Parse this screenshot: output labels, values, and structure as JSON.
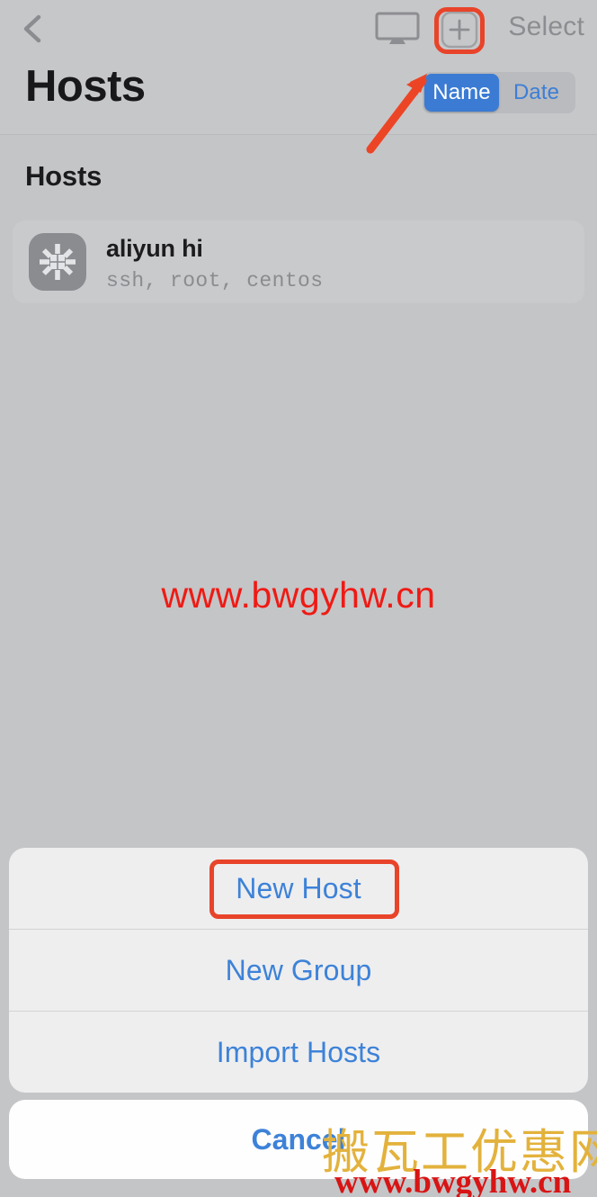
{
  "navbar": {
    "back_icon": "chevron-left-icon",
    "monitor_icon": "monitor-icon",
    "add_icon": "plus-square-icon",
    "select_label": "Select",
    "title": "Hosts"
  },
  "sort_control": {
    "options": [
      {
        "label": "Name",
        "selected": true
      },
      {
        "label": "Date",
        "selected": false
      }
    ],
    "selected_color": "#3b7bd3",
    "text_color": "#3d7ed6"
  },
  "content": {
    "section_header": "Hosts",
    "hosts": [
      {
        "avatar_icon": "centos-logo-icon",
        "name": "aliyun hi",
        "subtitle": "ssh, root, centos"
      }
    ]
  },
  "action_sheet": {
    "items": [
      {
        "label": "New Host",
        "highlighted": true
      },
      {
        "label": "New Group",
        "highlighted": false
      },
      {
        "label": "Import Hosts",
        "highlighted": false
      }
    ],
    "cancel_label": "Cancel"
  },
  "annotations": {
    "highlight_color": "#e8442a",
    "arrow": "red-arrow-pointing-up-right"
  },
  "watermarks": {
    "center_url": "www.bwgyhw.cn",
    "bottom_cn": "搬瓦工优惠网",
    "bottom_url": "www.bwgyhw.cn",
    "center_color": "#ef1a14",
    "cn_color": "#e3b23c",
    "bottom_url_color": "#d81414"
  }
}
